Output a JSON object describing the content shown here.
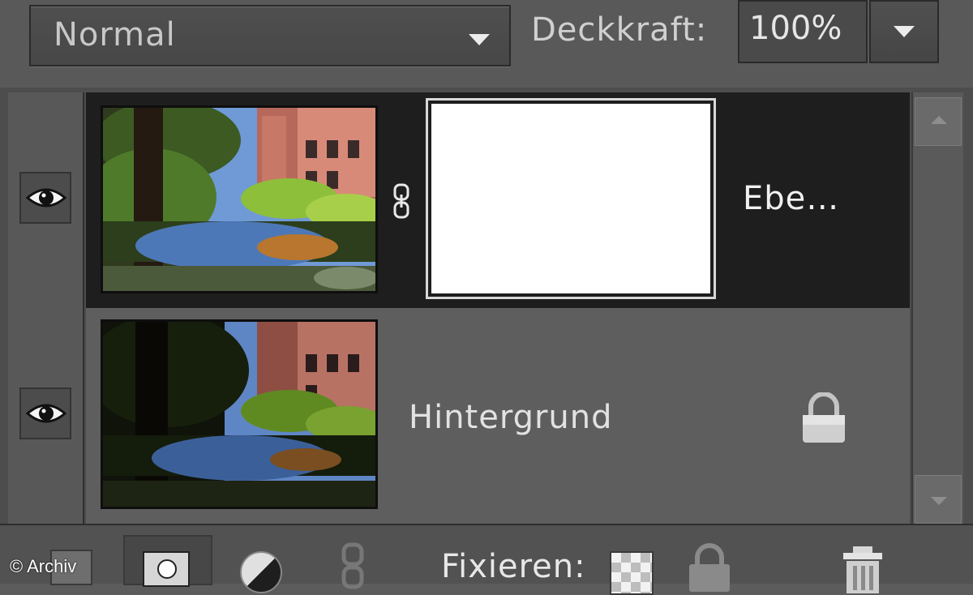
{
  "toolbar": {
    "blend_mode": "Normal",
    "opacity_label": "Deckkraft:",
    "opacity_value": "100%"
  },
  "layers": [
    {
      "name": "Ebe…",
      "visible": true,
      "selected": true,
      "has_mask": true,
      "locked": false
    },
    {
      "name": "Hintergrund",
      "visible": true,
      "selected": false,
      "has_mask": false,
      "locked": true
    }
  ],
  "bottom_bar": {
    "lock_label": "Fixieren:"
  },
  "watermark": "© Archiv",
  "icons": [
    "eye-icon",
    "chain-link-icon",
    "lock-icon",
    "new-layer-icon",
    "add-mask-icon",
    "adjustment-layer-icon",
    "link-layers-icon",
    "lock-transparency-icon",
    "lock-all-icon",
    "trash-icon"
  ],
  "colors": {
    "selected_row": "#1e1e1e",
    "row": "#5e5e5e",
    "panel": "#4d4d4d"
  }
}
